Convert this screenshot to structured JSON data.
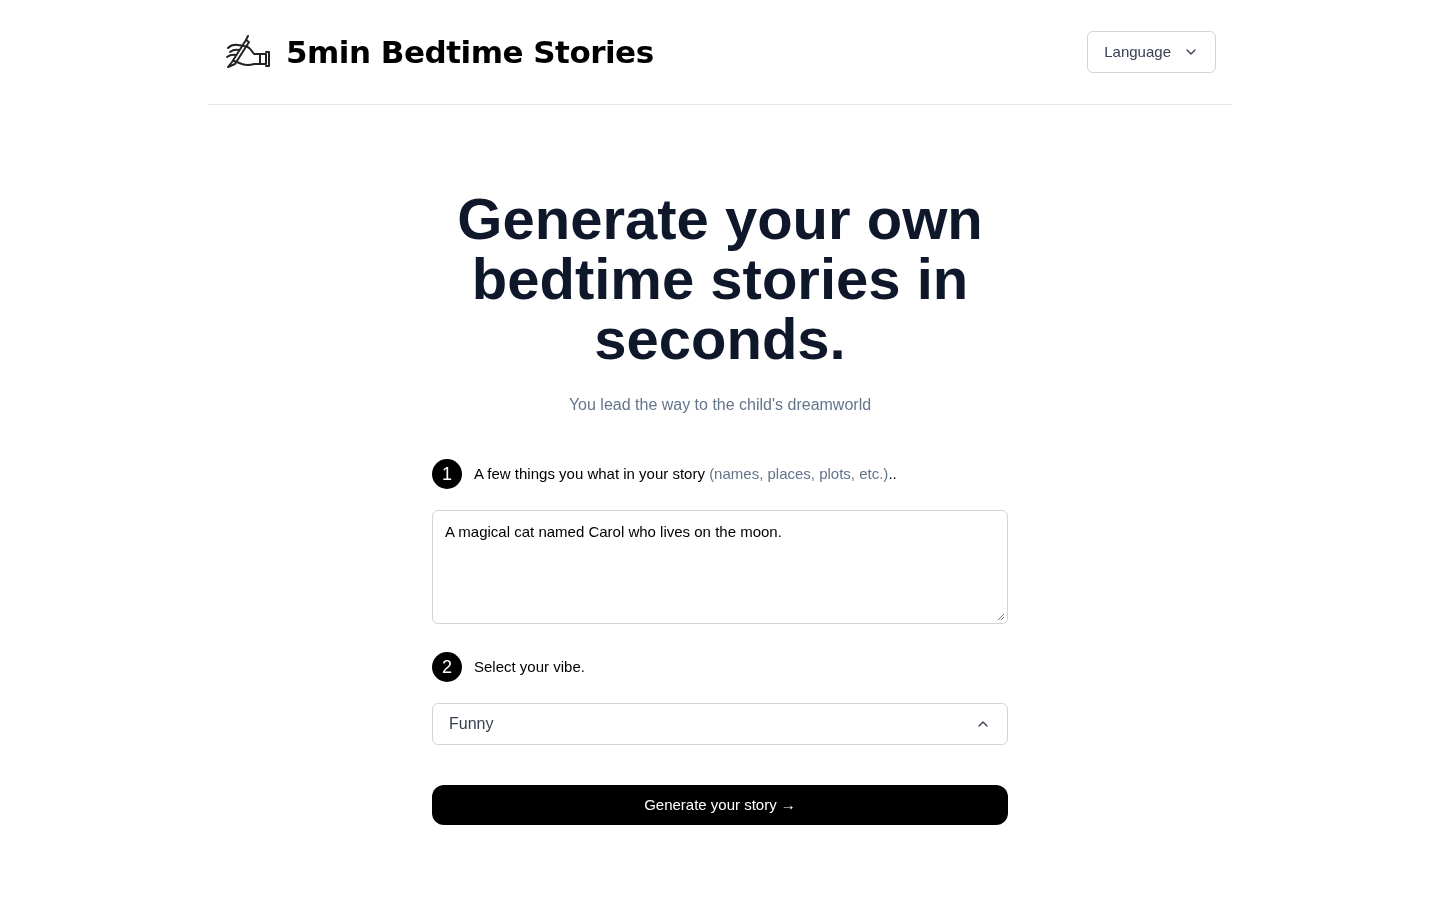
{
  "header": {
    "title": "5min Bedtime Stories",
    "language_button": "Language"
  },
  "hero": {
    "title": "Generate your own bedtime stories in seconds.",
    "subtitle": "You lead the way to the child's dreamworld"
  },
  "steps": [
    {
      "number": "1",
      "kind": "textarea",
      "label": "A few things you what in your story",
      "hint": "(names, places, plots, etc.)",
      "label_end": "..",
      "value": "A magical cat named Carol who lives on the moon."
    },
    {
      "number": "2",
      "kind": "select",
      "label": "Select your vibe.",
      "value": "Funny"
    }
  ],
  "generate_button": "Generate your story →"
}
